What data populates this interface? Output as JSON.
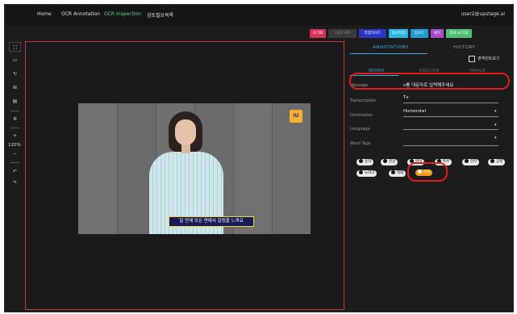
{
  "nav": {
    "items": [
      "Home",
      "OCR Annotation",
      "OCR Inspection",
      "검토필요목록"
    ],
    "active_index": 2,
    "user": "user2@upstage.ai"
  },
  "toolbar": {
    "buttons": [
      {
        "label": "초기화",
        "color": "#d3335a"
      },
      {
        "label": "OCR API",
        "color": "#3a3a3a"
      },
      {
        "label": "작업가이드",
        "color": "#2b35c4"
      },
      {
        "label": "정산작업",
        "color": "#28b6e6"
      },
      {
        "label": "업로드",
        "color": "#1f9ad6"
      },
      {
        "label": "패치",
        "color": "#a34bc9"
      },
      {
        "label": "완료 & 다음",
        "color": "#4fbf76"
      }
    ]
  },
  "left_tools": {
    "icons": [
      "select-icon",
      "rectangle-icon",
      "polygon-icon",
      "grid-icon",
      "text-box-icon",
      "settings-icon",
      "zoom-in-icon",
      "zoom-out-icon",
      "undo-icon",
      "redo-icon"
    ],
    "zoom_level": "120%",
    "plus": "+",
    "minus": "−"
  },
  "image": {
    "caption": "일 안에 모든 면에서 갈림을 느껴요",
    "logo_text": "IU"
  },
  "panel": {
    "tabs": [
      "ANNOTATIONS",
      "HISTORY"
    ],
    "checkbox_label": "영역힌트보기",
    "subtabs": [
      "WORD",
      "REGION",
      "IMAGE"
    ],
    "fields": [
      {
        "label": "Message",
        "value": "v를 대문자로 입력해주세요"
      },
      {
        "label": "Transcription",
        "value": "Tv"
      },
      {
        "label": "Orientation",
        "value": "Horizontal"
      },
      {
        "label": "Language",
        "value": ""
      },
      {
        "label": "Word Tags",
        "value": ""
      }
    ],
    "tags_row1": [
      "숫자",
      "한글",
      "영어",
      "특수",
      "한자",
      "공백"
    ],
    "tags_row2": [
      "노마크",
      "외래",
      "기타"
    ]
  },
  "colors": {
    "accent": "#3fa7e0",
    "highlight": "#e01c1c",
    "selected_tag": "#f39a1c"
  }
}
